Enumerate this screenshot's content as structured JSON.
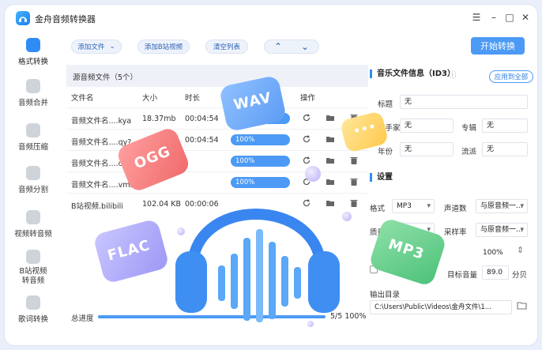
{
  "app": {
    "title": "金舟音频转换器"
  },
  "window_controls": {
    "menu": "☰",
    "minimize": "–",
    "maximize": "□",
    "close": "✕"
  },
  "sidebar": {
    "items": [
      {
        "label": "格式转换",
        "active": true
      },
      {
        "label": "音频合并"
      },
      {
        "label": "音频压缩"
      },
      {
        "label": "音频分割"
      },
      {
        "label": "视频转音频"
      },
      {
        "label": "B站视频转音频"
      },
      {
        "label": "歌词转换"
      }
    ]
  },
  "toolbar": {
    "add_file": "添加文件",
    "add_bilibili": "添加B站视频",
    "clear_list": "清空列表",
    "up": "⌃",
    "down": "⌄",
    "start": "开始转换"
  },
  "list": {
    "title": "源音频文件（5个）",
    "headers": {
      "name": "文件名",
      "size": "大小",
      "duration": "时长",
      "ops": "操作"
    },
    "rows": [
      {
        "name": "音频文件名....kya",
        "size": "18.37mb",
        "duration": "00:04:54",
        "progress": ""
      },
      {
        "name": "音频文件名....qy?",
        "size": "",
        "duration": "00:04:54",
        "progress": "100%"
      },
      {
        "name": "音频文件名....co",
        "size": "",
        "duration": "",
        "progress": "100%"
      },
      {
        "name": "音频文件名....vms",
        "size": "",
        "duration": "",
        "progress": "100%"
      },
      {
        "name": "B站视频.bilibili",
        "size": "102.04 KB",
        "duration": "00:00:06",
        "progress": ""
      }
    ],
    "total_label": "总进度",
    "total_count": "5/5",
    "total_percent": "100%"
  },
  "id3": {
    "title": "音乐文件信息（ID3）",
    "apply_all": "应用到全部",
    "fields": {
      "title_label": "标题",
      "title_value": "无",
      "artist_label": "歌手家",
      "artist_value": "无",
      "album_label": "专辑",
      "album_value": "无",
      "year_label": "年份",
      "year_value": "无",
      "genre_label": "流派",
      "genre_value": "无"
    }
  },
  "settings": {
    "title": "设置",
    "format_label": "格式",
    "format_value": "MP3",
    "channels_label": "声道数",
    "channels_value": "与原音频一...",
    "quality_label": "质量",
    "quality_value": "",
    "samplerate_label": "采样率",
    "samplerate_value": "与原音频一...",
    "volume_value": "100%",
    "target_label": "目标音量",
    "target_value": "89.0",
    "target_unit": "分贝",
    "output_label": "输出目录",
    "output_path": "C:\\Users\\Public\\Videos\\金舟文件\\1..."
  },
  "decor": {
    "wav": "WAV",
    "ogg": "OGG",
    "flac": "FLAC",
    "mp3": "MP3",
    "dots": "•••"
  },
  "colors": {
    "accent": "#4c9af5",
    "brand": "#2f8cf5"
  }
}
